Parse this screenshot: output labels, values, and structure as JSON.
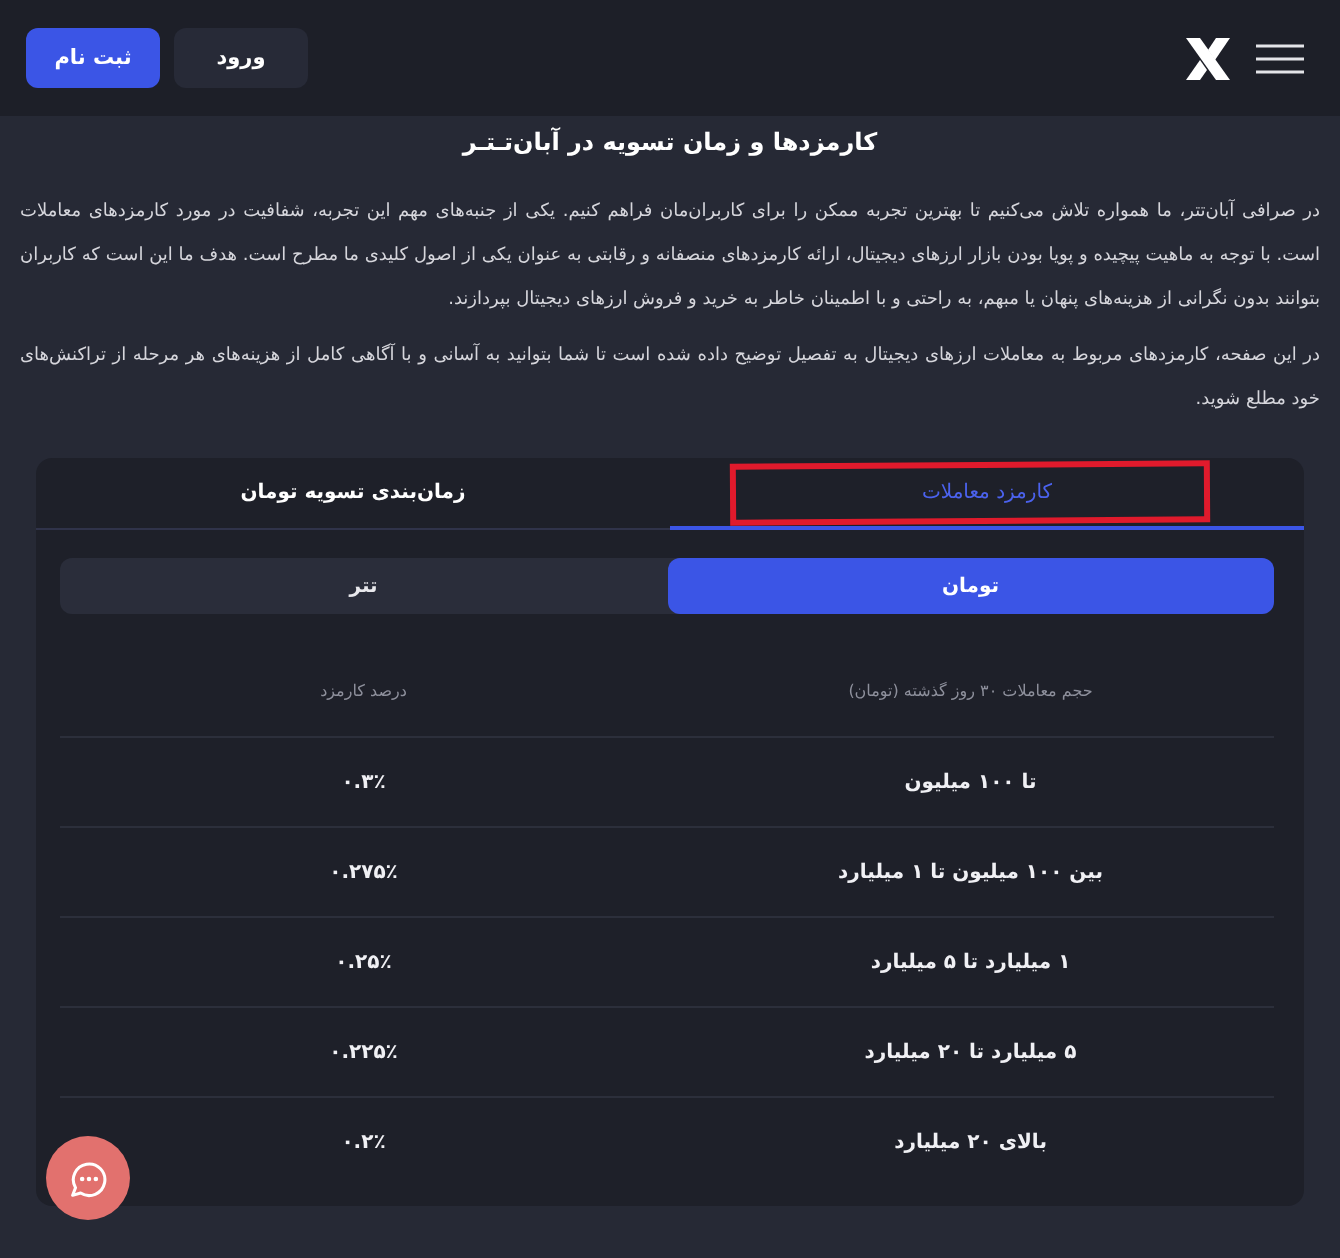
{
  "header": {
    "buttons": [
      {
        "label": "ورود",
        "kind": "secondary"
      },
      {
        "label": "ثبت نام",
        "kind": "primary"
      }
    ]
  },
  "title": "کارمزدها و زمان تسویه در آبان‌تـتـر",
  "paragraphs": [
    "در صرافی آبان‌تتر، ما همواره تلاش می‌کنیم تا بهترین تجربه ممکن را برای کاربران‌مان فراهم کنیم. یکی از جنبه‌های مهم این تجربه، شفافیت در مورد کارمزدهای معاملات است. با توجه به ماهیت پیچیده و پویا بودن بازار ارزهای دیجیتال، ارائه کارمزدهای منصفانه و رقابتی به عنوان یکی از اصول کلیدی ما مطرح است. هدف ما این است که کاربران بتوانند بدون نگرانی از هزینه‌های پنهان یا مبهم، به راحتی و با اطمینان خاطر به خرید و فروش ارزهای دیجیتال بپردازند.",
    "در این صفحه، کارمزدهای مربوط به معاملات ارزهای دیجیتال به تفصیل توضیح داده شده است تا شما بتوانید به آسانی و با آگاهی کامل از هزینه‌های هر مرحله از تراکنش‌های خود مطلع شوید."
  ],
  "tabs": [
    {
      "label": "کارمزد معاملات",
      "selected": true,
      "annotated": true
    },
    {
      "label": "زمان‌بندی تسویه تومان",
      "selected": false,
      "annotated": false
    }
  ],
  "currency_switch": [
    {
      "label": "تومان",
      "selected": true
    },
    {
      "label": "تتر",
      "selected": false
    }
  ],
  "table": {
    "columns": [
      "حجم معاملات ۳۰ روز گذشته (تومان)",
      "درصد کارمزد"
    ],
    "rows": [
      [
        "تا ۱۰۰ میلیون",
        "۰.۳٪"
      ],
      [
        "بین ۱۰۰ میلیون تا ۱ میلیارد",
        "۰.۲۷۵٪"
      ],
      [
        "۱ میلیارد تا ۵ میلیارد",
        "۰.۲۵٪"
      ],
      [
        "۵ میلیارد تا ۲۰ میلیارد",
        "۰.۲۲۵٪"
      ],
      [
        "بالای ۲۰ میلیارد",
        "۰.۲٪"
      ]
    ]
  }
}
